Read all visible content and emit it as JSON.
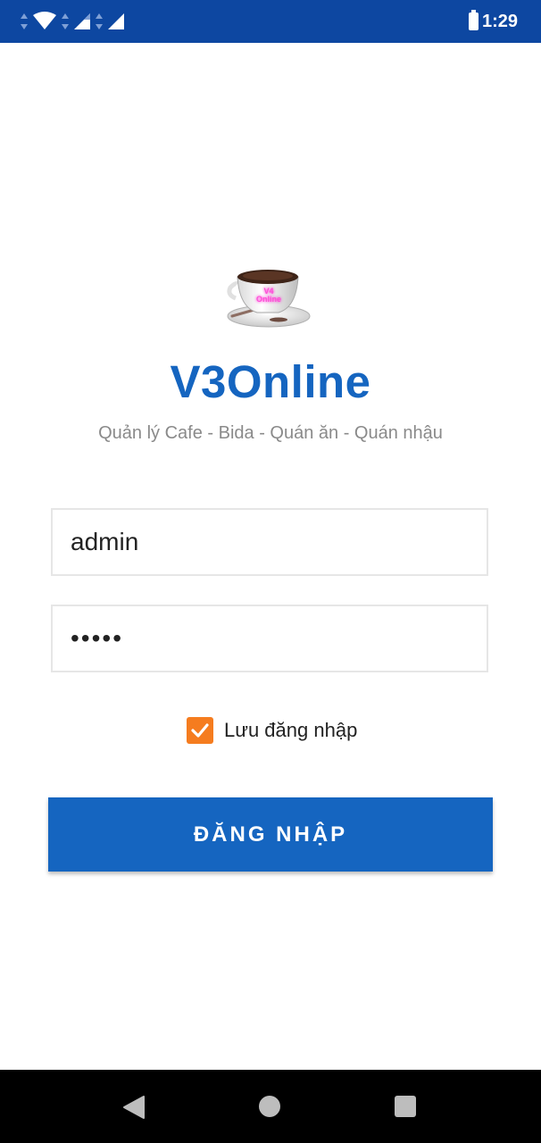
{
  "status_bar": {
    "time": "1:29",
    "icons": [
      "data-arrows-icon",
      "wifi-icon",
      "signal-icon",
      "battery-icon"
    ]
  },
  "app": {
    "logo_icon": "coffee-cup-logo-icon",
    "logo_text": "V4 Online",
    "title": "V3Online",
    "subtitle": "Quản lý Cafe - Bida - Quán ăn - Quán nhậu"
  },
  "login": {
    "username_value": "admin",
    "password_value": "12345",
    "remember_label": "Lưu đăng nhập",
    "remember_checked": true,
    "submit_label": "ĐĂNG NHẬP"
  },
  "colors": {
    "status_bar": "#0d47a1",
    "primary": "#1565c0",
    "checkbox": "#f57c1f",
    "nav_bar": "#000000"
  },
  "nav_bar": {
    "icons": [
      "back-icon",
      "home-icon",
      "recents-icon"
    ]
  }
}
